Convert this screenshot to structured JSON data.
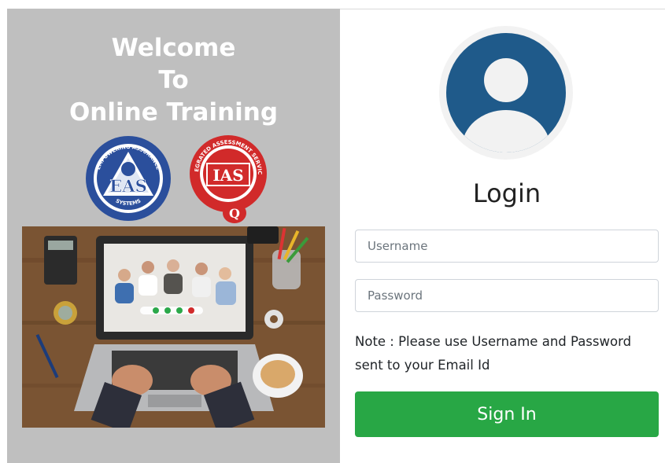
{
  "welcome": {
    "line1": "Welcome",
    "line2": "To",
    "line3": "Online Training"
  },
  "logos": {
    "eas": {
      "text": "EAS",
      "ring_top": "EMPOWERING ASSURANCE",
      "ring_bottom": "SYSTEMS"
    },
    "ias": {
      "text": "IAS",
      "ring_top": "INTEGRATED ASSESSMENT SERVICES",
      "sub": "Q"
    }
  },
  "photo": {
    "icon": "video-conference-laptop-image"
  },
  "login": {
    "avatar_icon": "user-avatar-icon",
    "title": "Login",
    "username_placeholder": "Username",
    "password_placeholder": "Password",
    "note": "Note : Please use Username and Password sent to your Email Id",
    "signin_label": "Sign In"
  },
  "colors": {
    "left_panel_bg": "#bfbfbf",
    "avatar_blue": "#1f5a8a",
    "signin_green": "#28a745",
    "eas_blue": "#2b4f9c",
    "ias_red": "#d12a2a"
  }
}
